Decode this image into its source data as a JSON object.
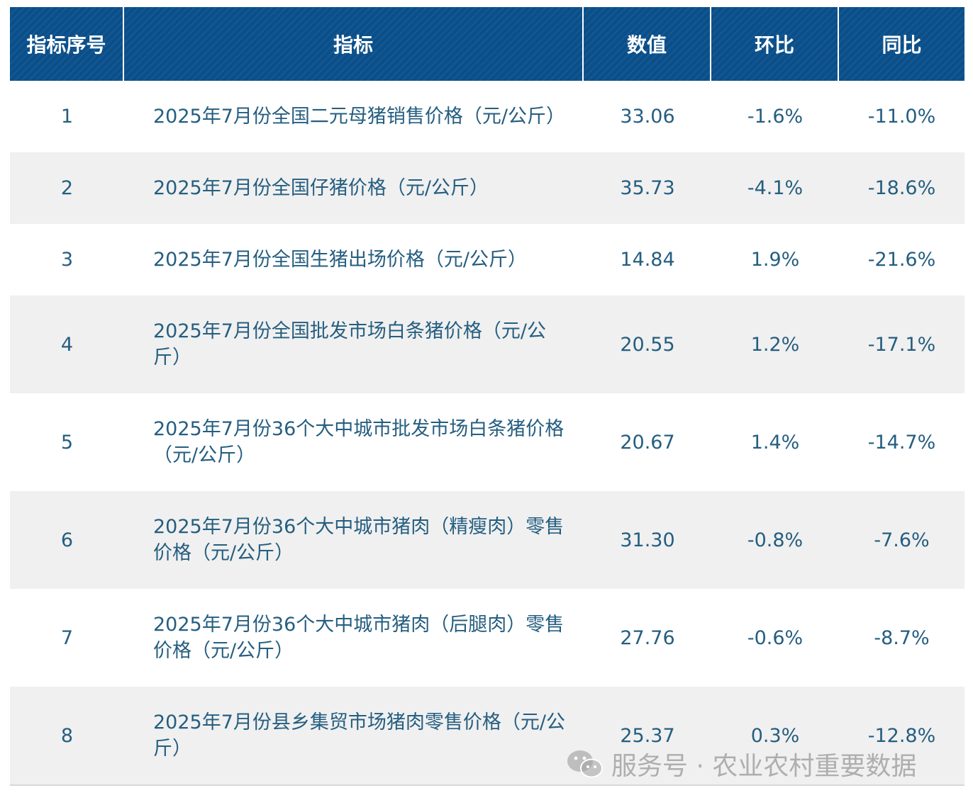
{
  "table": {
    "headers": [
      "指标序号",
      "指标",
      "数值",
      "环比",
      "同比"
    ],
    "rows": [
      {
        "no": "1",
        "indicator": "2025年7月份全国二元母猪销售价格（元/公斤）",
        "value": "33.06",
        "mom": "-1.6%",
        "yoy": "-11.0%"
      },
      {
        "no": "2",
        "indicator": "2025年7月份全国仔猪价格（元/公斤）",
        "value": "35.73",
        "mom": "-4.1%",
        "yoy": "-18.6%"
      },
      {
        "no": "3",
        "indicator": "2025年7月份全国生猪出场价格（元/公斤）",
        "value": "14.84",
        "mom": "1.9%",
        "yoy": "-21.6%"
      },
      {
        "no": "4",
        "indicator": "2025年7月份全国批发市场白条猪价格（元/公斤）",
        "value": "20.55",
        "mom": "1.2%",
        "yoy": "-17.1%"
      },
      {
        "no": "5",
        "indicator": "2025年7月份36个大中城市批发市场白条猪价格（元/公斤）",
        "value": "20.67",
        "mom": "1.4%",
        "yoy": "-14.7%"
      },
      {
        "no": "6",
        "indicator": "2025年7月份36个大中城市猪肉（精瘦肉）零售价格（元/公斤）",
        "value": "31.30",
        "mom": "-0.8%",
        "yoy": "-7.6%"
      },
      {
        "no": "7",
        "indicator": "2025年7月份36个大中城市猪肉（后腿肉）零售价格（元/公斤）",
        "value": "27.76",
        "mom": "-0.6%",
        "yoy": "-8.7%"
      },
      {
        "no": "8",
        "indicator": "2025年7月份县乡集贸市场猪肉零售价格（元/公斤）",
        "value": "25.37",
        "mom": "0.3%",
        "yoy": "-12.8%"
      }
    ]
  },
  "watermark": {
    "text": "服务号 · 农业农村重要数据",
    "icon": "wechat-icon"
  }
}
